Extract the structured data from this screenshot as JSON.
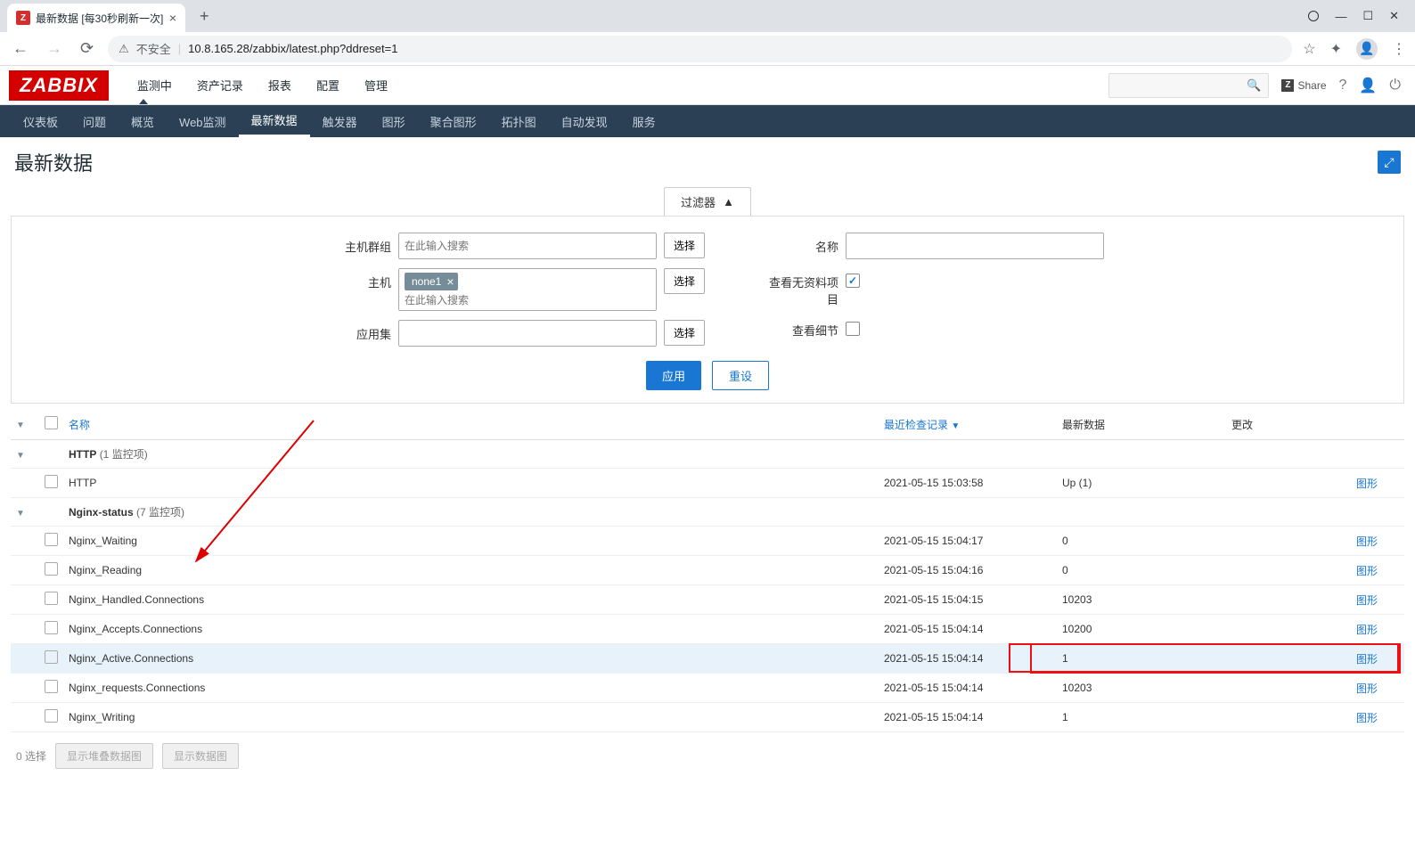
{
  "browser": {
    "tab_title": "最新数据 [每30秒刷新一次]",
    "url_prefix": "不安全",
    "url": "10.8.165.28/zabbix/latest.php?ddreset=1"
  },
  "header": {
    "logo": "ZABBIX",
    "nav": [
      "监测中",
      "资产记录",
      "报表",
      "配置",
      "管理"
    ],
    "nav_active": 0,
    "share": "Share"
  },
  "subnav": {
    "items": [
      "仪表板",
      "问题",
      "概览",
      "Web监测",
      "最新数据",
      "触发器",
      "图形",
      "聚合图形",
      "拓扑图",
      "自动发现",
      "服务"
    ],
    "active": 4
  },
  "page_title": "最新数据",
  "filter": {
    "toggle_label": "过滤器",
    "host_group_label": "主机群组",
    "host_group_placeholder": "在此输入搜索",
    "host_label": "主机",
    "host_chip": "none1",
    "host_placeholder": "在此输入搜索",
    "app_label": "应用集",
    "name_label": "名称",
    "nodata_label": "查看无资料项目",
    "nodata_checked": true,
    "detail_label": "查看细节",
    "detail_checked": false,
    "select_btn": "选择",
    "apply": "应用",
    "reset": "重设"
  },
  "table": {
    "headers": {
      "name": "名称",
      "lastcheck": "最近检查记录",
      "latest": "最新数据",
      "change": "更改"
    },
    "groups": [
      {
        "name": "HTTP",
        "count_label": "(1 监控项)",
        "rows": [
          {
            "name": "HTTP",
            "lastcheck": "2021-05-15 15:03:58",
            "latest": "Up (1)",
            "graph": "图形"
          }
        ]
      },
      {
        "name": "Nginx-status",
        "count_label": "(7 监控项)",
        "rows": [
          {
            "name": "Nginx_Waiting",
            "lastcheck": "2021-05-15 15:04:17",
            "latest": "0",
            "graph": "图形"
          },
          {
            "name": "Nginx_Reading",
            "lastcheck": "2021-05-15 15:04:16",
            "latest": "0",
            "graph": "图形"
          },
          {
            "name": "Nginx_Handled.Connections",
            "lastcheck": "2021-05-15 15:04:15",
            "latest": "10203",
            "graph": "图形"
          },
          {
            "name": "Nginx_Accepts.Connections",
            "lastcheck": "2021-05-15 15:04:14",
            "latest": "10200",
            "graph": "图形"
          },
          {
            "name": "Nginx_Active.Connections",
            "lastcheck": "2021-05-15 15:04:14",
            "latest": "1",
            "graph": "图形",
            "highlight": true
          },
          {
            "name": "Nginx_requests.Connections",
            "lastcheck": "2021-05-15 15:04:14",
            "latest": "10203",
            "graph": "图形"
          },
          {
            "name": "Nginx_Writing",
            "lastcheck": "2021-05-15 15:04:14",
            "latest": "1",
            "graph": "图形"
          }
        ]
      }
    ]
  },
  "footer": {
    "selected": "0 选择",
    "stacked_btn": "显示堆叠数据图",
    "graph_btn": "显示数据图"
  }
}
